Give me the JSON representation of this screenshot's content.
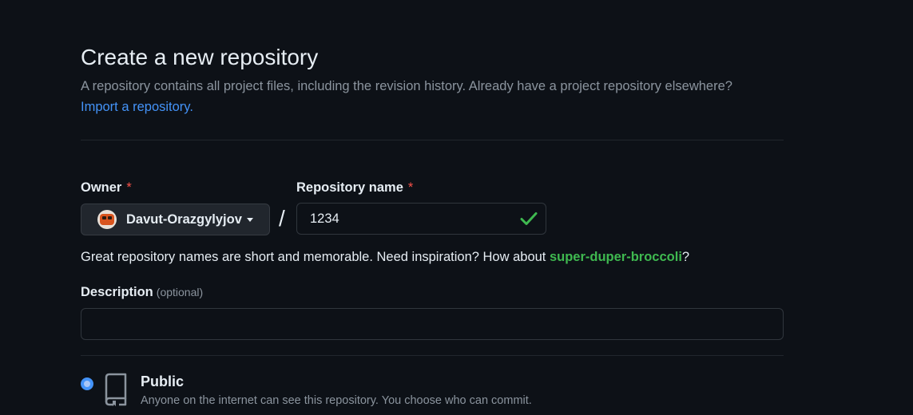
{
  "header": {
    "title": "Create a new repository",
    "subtitle": "A repository contains all project files, including the revision history. Already have a project repository elsewhere?",
    "import_link": "Import a repository."
  },
  "owner": {
    "label": "Owner",
    "required_mark": "*",
    "value": "Davut-Orazgylyjov",
    "icon": "avatar"
  },
  "separator": "/",
  "repository": {
    "label": "Repository name",
    "required_mark": "*",
    "value": "1234",
    "status_icon": "check-icon"
  },
  "hint": {
    "text": "Great repository names are short and memorable. Need inspiration? How about ",
    "suggestion": "super-duper-broccoli",
    "suffix": "?"
  },
  "description": {
    "label": "Description",
    "optional": "(optional)",
    "value": ""
  },
  "visibility": {
    "public": {
      "label": "Public",
      "description": "Anyone on the internet can see this repository. You choose who can commit.",
      "selected": true,
      "icon": "repo-icon"
    }
  },
  "colors": {
    "background": "#0d1117",
    "link": "#4493f8",
    "success": "#3fb950",
    "required": "#f85149",
    "muted": "#8b949e"
  }
}
